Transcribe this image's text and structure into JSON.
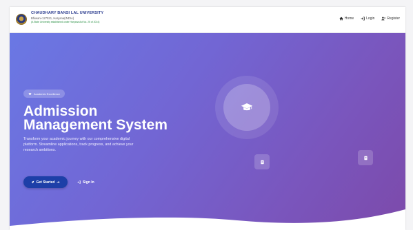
{
  "header": {
    "university_name": "CHAUDHARY BANSI LAL UNIVERSITY",
    "location": "Bhiwani-127021, Haryana(INDIA)",
    "note": "(A State University established under Haryana Act No. 25 of 2014)"
  },
  "nav": {
    "home": "Home",
    "login": "Login",
    "register": "Register"
  },
  "hero": {
    "badge": "Academic Excellence",
    "title_line1": "Admission",
    "title_line2": "Management System",
    "description": "Transform your academic journey with our comprehensive digital platform. Streamline applications, track progress, and achieve your research ambitions.",
    "get_started": "Get Started",
    "sign_in": "Sign In"
  },
  "colors": {
    "gradient_start": "#6a78e4",
    "gradient_end": "#7c4aaa",
    "primary_button": "#1d3fa8",
    "brand_text": "#2b3c8f"
  },
  "icons": {
    "nav_home": "home-icon",
    "nav_login": "login-icon",
    "nav_register": "user-plus-icon",
    "badge": "graduation-cap-icon",
    "get_started": "rocket-icon",
    "sign_in": "sign-in-icon",
    "hero": "graduation-cap-icon",
    "float_left": "document-icon",
    "float_right": "file-icon"
  }
}
